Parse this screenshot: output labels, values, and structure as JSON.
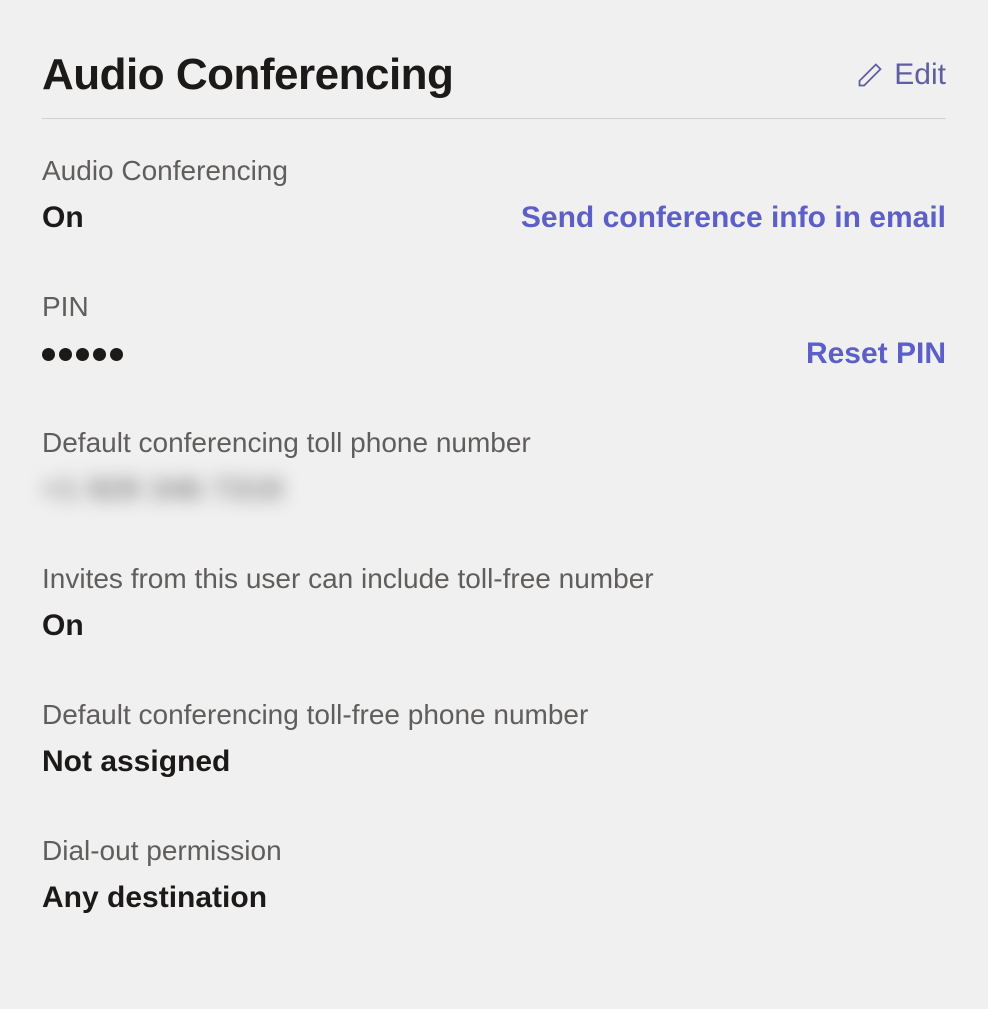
{
  "header": {
    "title": "Audio Conferencing",
    "edit_label": "Edit"
  },
  "fields": {
    "audio_conferencing": {
      "label": "Audio Conferencing",
      "value": "On",
      "action": "Send conference info in email"
    },
    "pin": {
      "label": "PIN",
      "dot_count": 5,
      "action": "Reset PIN"
    },
    "toll_number": {
      "label": "Default conferencing toll phone number",
      "value": "+1 929 346 7319"
    },
    "toll_free_include": {
      "label": "Invites from this user can include toll-free number",
      "value": "On"
    },
    "toll_free_number": {
      "label": "Default conferencing toll-free phone number",
      "value": "Not assigned"
    },
    "dial_out": {
      "label": "Dial-out permission",
      "value": "Any destination"
    }
  }
}
